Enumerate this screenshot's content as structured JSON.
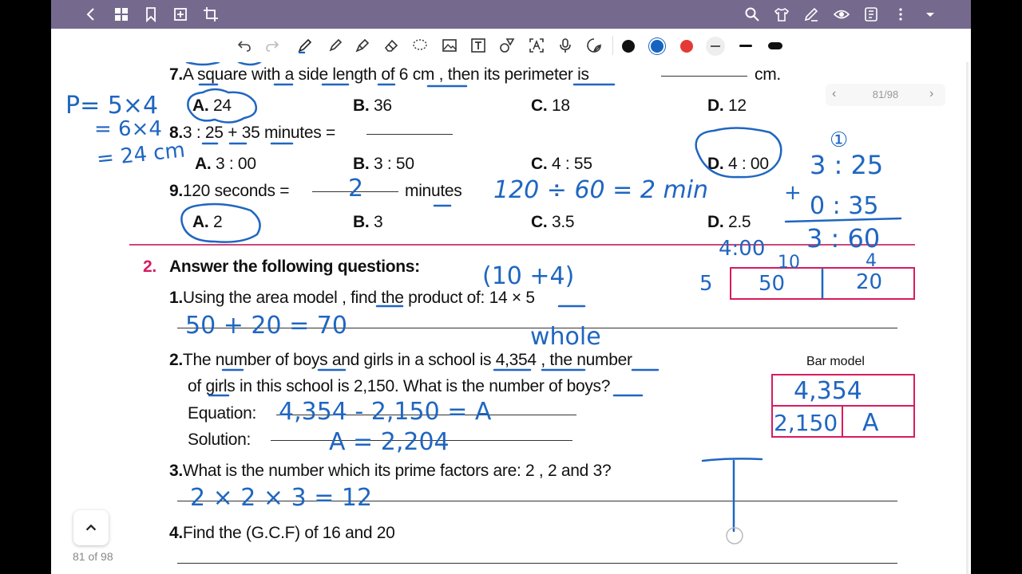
{
  "topbar": {
    "icons_left": [
      "back-icon",
      "grid-icon",
      "bookmark-icon",
      "add-page-icon",
      "crop-icon"
    ],
    "icons_right": [
      "search-icon",
      "shirt-icon",
      "pen-edit-icon",
      "eye-icon",
      "reader-icon",
      "more-icon",
      "dropdown-icon"
    ]
  },
  "toolbar": {
    "tools": [
      "undo-icon",
      "redo-icon",
      "pen-icon",
      "highlighter-icon",
      "brush-icon",
      "eraser-icon",
      "lasso-icon",
      "image-icon",
      "text-box-icon",
      "shapes-icon",
      "text-recognize-icon",
      "mic-icon",
      "sticker-icon"
    ],
    "colors": [
      "#111111",
      "#1565c0",
      "#e53935",
      "#555555",
      "#111111",
      "#111111"
    ]
  },
  "pager": {
    "label": "81/98",
    "prev": "‹",
    "next": "›"
  },
  "worksheet": {
    "q7": {
      "num": "7.",
      "text": "A square with a side length of 6 cm , then its perimeter is",
      "unit": "cm.",
      "a_l": "A.",
      "a": "24",
      "b_l": "B.",
      "b": "36",
      "c_l": "C.",
      "c": "18",
      "d_l": "D.",
      "d": "12"
    },
    "q8": {
      "num": "8.",
      "text": "3 : 25 + 35 minutes =",
      "a_l": "A.",
      "a": "3 : 00",
      "b_l": "B.",
      "b": "3 : 50",
      "c_l": "C.",
      "c": "4 : 55",
      "d_l": "D.",
      "d": "4 : 00"
    },
    "q9": {
      "num": "9.",
      "text": "120 seconds =",
      "unit": "minutes",
      "a_l": "A.",
      "a": "2",
      "b_l": "B.",
      "b": "3",
      "c_l": "C.",
      "c": "3.5",
      "d_l": "D.",
      "d": "2.5"
    },
    "section2": {
      "num": "2.",
      "title": "Answer the following questions:"
    },
    "p1": {
      "num": "1.",
      "text": "Using the area model , find the product of: 14 × 5"
    },
    "p2": {
      "num": "2.",
      "line1": "The number of boys and girls in a school is 4,354 , the number",
      "line2": "of girls in this school is 2,150. What is the number of boys?",
      "eq_label": "Equation:",
      "sol_label": "Solution:"
    },
    "bar_model": {
      "title": "Bar model"
    },
    "p3": {
      "num": "3.",
      "text": "What is the number which its prime factors are: 2 , 2 and 3?"
    },
    "p4": {
      "num": "4.",
      "text": "Find the (G.C.F) of 16 and 20"
    }
  },
  "handwriting": {
    "perimeter_1": "P= 5×4",
    "perimeter_2": "= 6×4",
    "perimeter_3": "= 24 cm",
    "time_calc": "120 ÷ 60 = 2 min",
    "q9_answer": "2",
    "step_1": "①",
    "add_top": "3 : 25",
    "add_plus": "+",
    "add_mid": "0 : 35",
    "add_result": "3 : 60",
    "add_final": "4:00",
    "area_split": "(10 +4)",
    "area_row": "5",
    "area_top_left": "10",
    "area_top_right": "4",
    "area_cell_left": "50",
    "area_cell_right": "20",
    "p1_answer": "50 + 20 = 70",
    "whole": "whole",
    "eq_answer": "4,354 - 2,150 = A",
    "sol_answer": "A = 2,204",
    "bar_total": "4,354",
    "bar_part": "2,150",
    "bar_unknown": "A",
    "p3_answer": "2 × 2 × 3 = 12"
  },
  "footer": {
    "page_count": "81 of 98"
  }
}
